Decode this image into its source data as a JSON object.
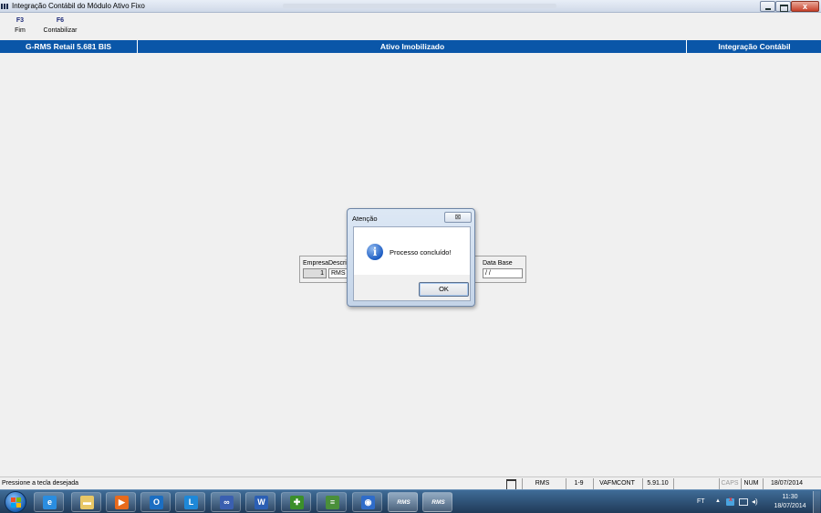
{
  "window": {
    "title": "Integração Contábil do Módulo Ativo Fixo",
    "close_glyph": "x"
  },
  "toolbar": {
    "keys": [
      {
        "key": "F3",
        "label": "Fim"
      },
      {
        "key": "F6",
        "label": "Contabilizar"
      }
    ]
  },
  "header": {
    "left": "G-RMS Retail 5.681 BIS",
    "center": "Ativo Imobilizado",
    "right": "Integração Contábil"
  },
  "form": {
    "empresa_label": "Empresa",
    "empresa_value": "1",
    "descr_label": "Descri",
    "descr_value": "RMS -",
    "database_label": "Data Base",
    "database_value": "/ /"
  },
  "dialog": {
    "title": "Atenção",
    "close_glyph": "⊠",
    "icon_glyph": "i",
    "message": "Processo concluído!",
    "ok_label": "OK"
  },
  "statusbar": {
    "message": "Pressione a tecla desejada",
    "panels": {
      "rms": "RMS",
      "range": "1-9",
      "program": "VAFMCONT",
      "version": "5.91.10",
      "blank": "",
      "caps": "CAPS",
      "num": "NUM",
      "date": "18/07/2014"
    }
  },
  "taskbar": {
    "items": [
      {
        "name": "internet-explorer",
        "glyph": "e",
        "color": "#2a8de0"
      },
      {
        "name": "file-explorer",
        "glyph": "▬",
        "color": "#e8c766"
      },
      {
        "name": "media-player",
        "glyph": "▶",
        "color": "#e86a1c"
      },
      {
        "name": "outlook",
        "glyph": "O",
        "color": "#1b6ec2"
      },
      {
        "name": "lync",
        "glyph": "L",
        "color": "#1e88d8"
      },
      {
        "name": "app-infinity",
        "glyph": "∞",
        "color": "#3a5fb0"
      },
      {
        "name": "word",
        "glyph": "W",
        "color": "#2b5fb4"
      },
      {
        "name": "app-green-cross",
        "glyph": "✚",
        "color": "#3b8f2a"
      },
      {
        "name": "app-stack",
        "glyph": "≡",
        "color": "#4a8f3a"
      },
      {
        "name": "app-globe",
        "glyph": "◉",
        "color": "#2f6cc9"
      },
      {
        "name": "rms-1",
        "glyph": "RMS",
        "color": "transparent"
      },
      {
        "name": "rms-2",
        "glyph": "RMS",
        "color": "transparent"
      }
    ],
    "tray": {
      "lang": "FT",
      "up_glyph": "▲",
      "volume_glyph": "◂)",
      "time": "11:30",
      "date": "18/07/2014"
    }
  }
}
